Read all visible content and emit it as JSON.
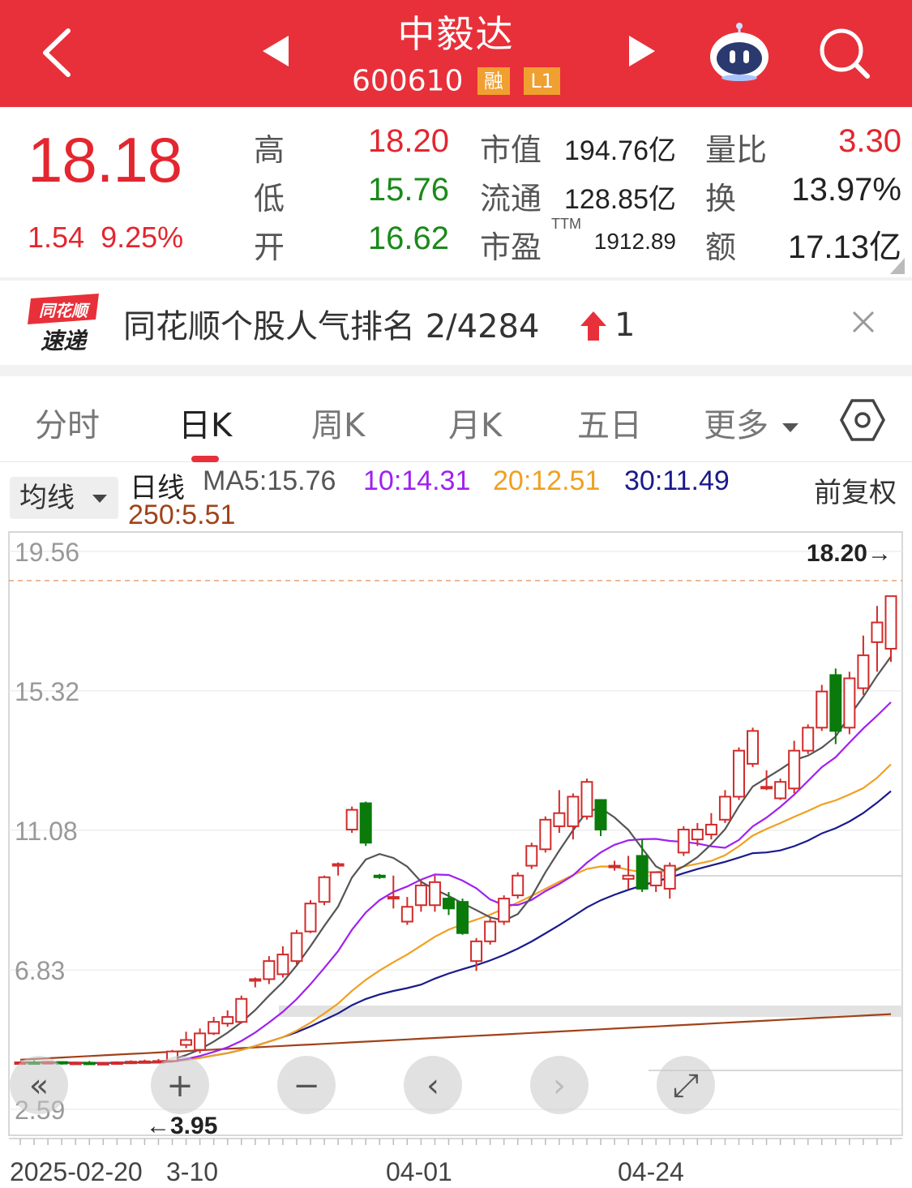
{
  "header": {
    "title": "中毅达",
    "code": "600610",
    "tags": [
      "融",
      "L1"
    ]
  },
  "quote": {
    "price": "18.18",
    "change": "1.54",
    "change_pct": "9.25%",
    "high_label": "高",
    "high": "18.20",
    "low_label": "低",
    "low": "15.76",
    "open_label": "开",
    "open": "16.62",
    "mktcap_label": "市值",
    "mktcap": "194.76亿",
    "float_label": "流通",
    "float": "128.85亿",
    "pe_label": "市盈",
    "pe_sup": "TTM",
    "pe": "1912.89",
    "volratio_label": "量比",
    "volratio": "3.30",
    "turnover_label": "换",
    "turnover": "13.97%",
    "amount_label": "额",
    "amount": "17.13亿"
  },
  "news": {
    "logo_top": "同花顺",
    "logo_bottom": "速递",
    "text": "同花顺个股人气排名 2/4284",
    "rank_change": "1"
  },
  "tabs": [
    "分时",
    "日K",
    "周K",
    "月K",
    "五日",
    "更多"
  ],
  "active_tab": 1,
  "ma": {
    "selector": "均线",
    "period": "日线",
    "ma5": "MA5:15.76",
    "ma10": "10:14.31",
    "ma20": "20:12.51",
    "ma30": "30:11.49",
    "ma250": "250:5.51",
    "adjust": "前复权",
    "colors": {
      "ma5": "#555555",
      "ma10": "#a020f0",
      "ma20": "#f0a020",
      "ma30": "#1a1a8c",
      "ma250": "#a0421a",
      "up": "#d22b2b",
      "down": "#0a7a0a"
    }
  },
  "chart_data": {
    "type": "candlestick",
    "y_ticks": [
      "19.56",
      "15.32",
      "11.08",
      "6.83",
      "2.59"
    ],
    "ylim": [
      2.59,
      19.56
    ],
    "x_ticks": [
      "2025-02-20",
      "3-10",
      "04-01",
      "04-24"
    ],
    "max_marker": "18.20→",
    "min_marker": "←3.95",
    "grid": true
  },
  "chart_controls": [
    "«",
    "+",
    "−",
    "‹",
    "›",
    "⤢"
  ]
}
